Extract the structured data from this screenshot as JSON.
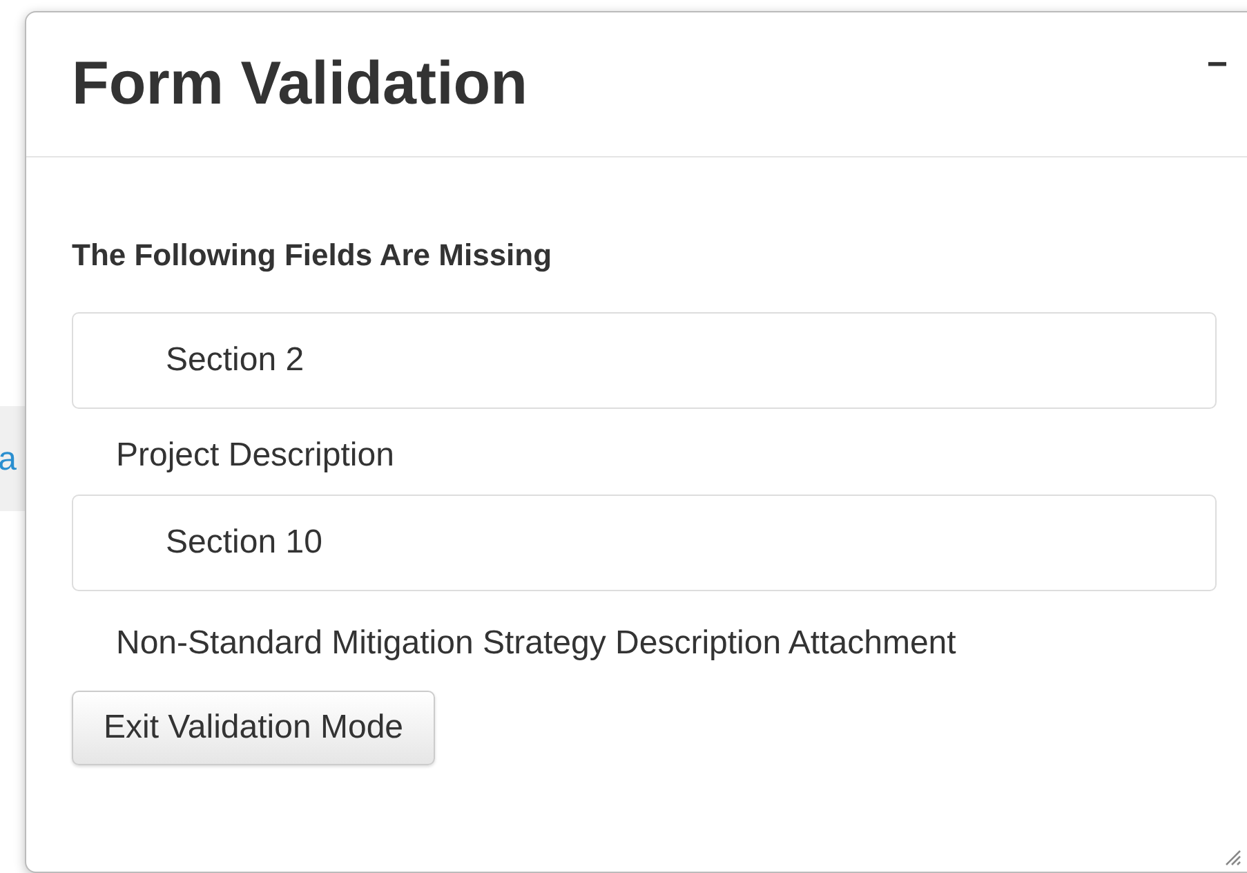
{
  "background": {
    "link_fragment": "a"
  },
  "dialog": {
    "title": "Form Validation",
    "minimize_symbol": "−",
    "heading": "The Following Fields Are Missing",
    "groups": [
      {
        "section": "Section 2",
        "fields": [
          "Project Description"
        ]
      },
      {
        "section": "Section 10",
        "fields": [
          "Non-Standard Mitigation Strategy Description Attachment"
        ]
      }
    ],
    "button": "Exit Validation Mode"
  }
}
